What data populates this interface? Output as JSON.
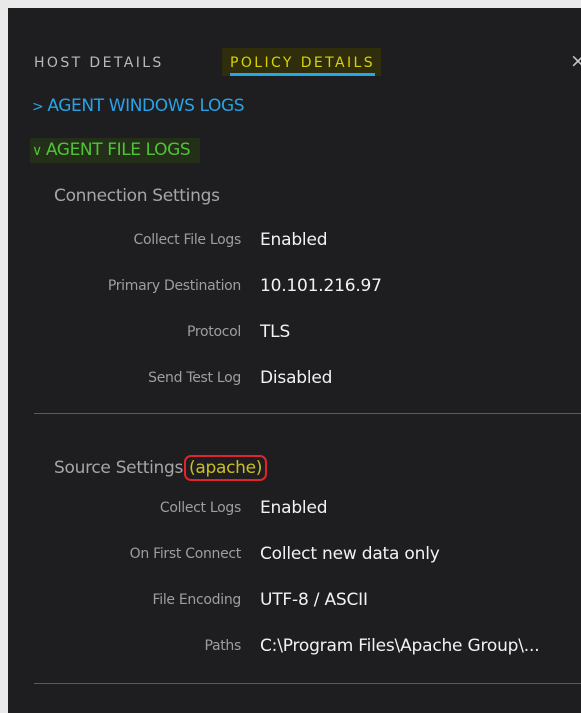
{
  "tabs": {
    "host": "HOST DETAILS",
    "policy": "POLICY DETAILS",
    "close_glyph": "×"
  },
  "sections": {
    "windows_logs": {
      "chevron": ">",
      "label": "AGENT WINDOWS LOGS"
    },
    "file_logs": {
      "chevron": "∨",
      "label": "AGENT FILE LOGS"
    }
  },
  "connection": {
    "title": "Connection Settings",
    "rows": [
      {
        "label": "Collect File Logs",
        "value": "Enabled"
      },
      {
        "label": "Primary Destination",
        "value": "10.101.216.97"
      },
      {
        "label": "Protocol",
        "value": "TLS"
      },
      {
        "label": "Send Test Log",
        "value": "Disabled"
      }
    ]
  },
  "source": {
    "title": "Source Settings",
    "name": "(apache)",
    "rows": [
      {
        "label": "Collect Logs",
        "value": "Enabled"
      },
      {
        "label": "On First Connect",
        "value": "Collect new data only"
      },
      {
        "label": "File Encoding",
        "value": "UTF-8 / ASCII"
      },
      {
        "label": "Paths",
        "value": "C:\\Program Files\\Apache Group\\..."
      }
    ]
  },
  "colors": {
    "panel_bg": "#1e1e21",
    "active_tab_text": "#d8d400",
    "tab_underline": "#23a8e3",
    "windows_logs": "#28a3e8",
    "file_logs": "#4fc436",
    "highlight_box": "#e0242c"
  },
  "icons": {
    "close": "close-icon",
    "collapsed": "chevron-right-icon",
    "expanded": "chevron-down-icon"
  }
}
